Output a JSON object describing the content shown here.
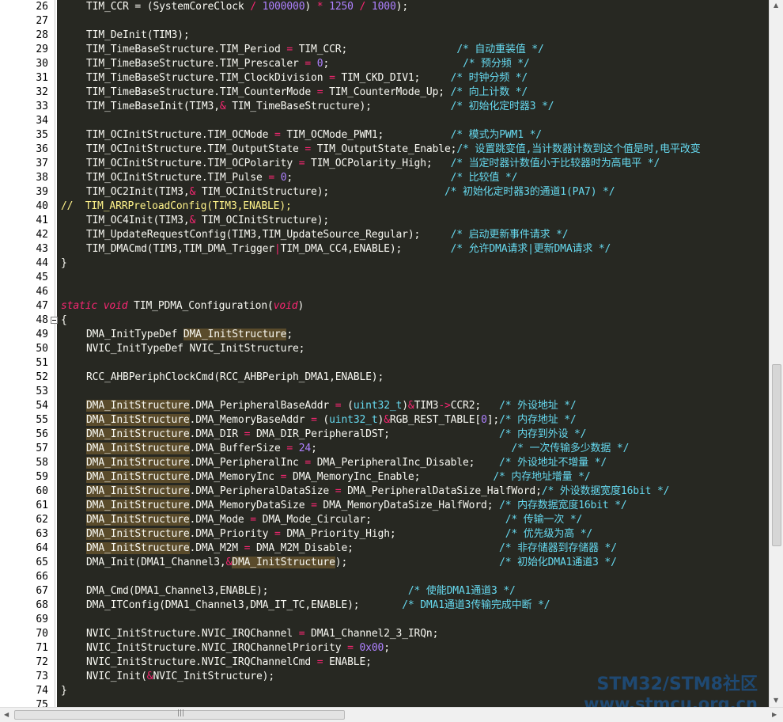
{
  "lines": [
    {
      "n": "26",
      "segs": [
        [
          "TIM_CCR = (SystemCoreClock ",
          ""
        ],
        [
          "/",
          "op"
        ],
        [
          " ",
          ""
        ],
        [
          "1000000",
          "num"
        ],
        [
          ") ",
          ""
        ],
        [
          "*",
          "op"
        ],
        [
          " ",
          ""
        ],
        [
          "1250",
          "num"
        ],
        [
          " ",
          ""
        ],
        [
          "/",
          "op"
        ],
        [
          " ",
          ""
        ],
        [
          "1000",
          "num"
        ],
        [
          ");",
          ""
        ]
      ]
    },
    {
      "n": "27",
      "segs": []
    },
    {
      "n": "28",
      "segs": [
        [
          "TIM_DeInit(TIM3);",
          ""
        ]
      ]
    },
    {
      "n": "29",
      "segs": [
        [
          "TIM_TimeBaseStructure.TIM_Period ",
          ""
        ],
        [
          "=",
          "op"
        ],
        [
          " TIM_CCR;                  ",
          ""
        ],
        [
          "/* 自动重装值 */",
          "cmt"
        ]
      ]
    },
    {
      "n": "30",
      "segs": [
        [
          "TIM_TimeBaseStructure.TIM_Prescaler ",
          ""
        ],
        [
          "=",
          "op"
        ],
        [
          " ",
          ""
        ],
        [
          "0",
          "num"
        ],
        [
          ";                      ",
          ""
        ],
        [
          "/* 预分频 */",
          "cmt"
        ]
      ]
    },
    {
      "n": "31",
      "segs": [
        [
          "TIM_TimeBaseStructure.TIM_ClockDivision ",
          ""
        ],
        [
          "=",
          "op"
        ],
        [
          " TIM_CKD_DIV1;     ",
          ""
        ],
        [
          "/* 时钟分频 */",
          "cmt"
        ]
      ]
    },
    {
      "n": "32",
      "segs": [
        [
          "TIM_TimeBaseStructure.TIM_CounterMode ",
          ""
        ],
        [
          "=",
          "op"
        ],
        [
          " TIM_CounterMode_Up; ",
          ""
        ],
        [
          "/* 向上计数 */",
          "cmt"
        ]
      ]
    },
    {
      "n": "33",
      "segs": [
        [
          "TIM_TimeBaseInit(TIM3,",
          ""
        ],
        [
          "&",
          "op"
        ],
        [
          " TIM_TimeBaseStructure);             ",
          ""
        ],
        [
          "/* 初始化定时器3 */",
          "cmt"
        ]
      ]
    },
    {
      "n": "34",
      "segs": []
    },
    {
      "n": "35",
      "segs": [
        [
          "TIM_OCInitStructure.TIM_OCMode ",
          ""
        ],
        [
          "=",
          "op"
        ],
        [
          " TIM_OCMode_PWM1;           ",
          ""
        ],
        [
          "/* 模式为PWM1 */",
          "cmt"
        ]
      ]
    },
    {
      "n": "36",
      "segs": [
        [
          "TIM_OCInitStructure.TIM_OutputState ",
          ""
        ],
        [
          "=",
          "op"
        ],
        [
          " TIM_OutputState_Enable;",
          ""
        ],
        [
          "/* 设置跳变值,当计数器计数到这个值是时,电平改变",
          "cmt"
        ]
      ]
    },
    {
      "n": "37",
      "segs": [
        [
          "TIM_OCInitStructure.TIM_OCPolarity ",
          ""
        ],
        [
          "=",
          "op"
        ],
        [
          " TIM_OCPolarity_High;   ",
          ""
        ],
        [
          "/* 当定时器计数值小于比较器时为高电平 */",
          "cmt"
        ]
      ]
    },
    {
      "n": "38",
      "segs": [
        [
          "TIM_OCInitStructure.TIM_Pulse ",
          ""
        ],
        [
          "=",
          "op"
        ],
        [
          " ",
          ""
        ],
        [
          "0",
          "num"
        ],
        [
          ";                          ",
          ""
        ],
        [
          "/* 比较值 */",
          "cmt"
        ]
      ]
    },
    {
      "n": "39",
      "segs": [
        [
          "TIM_OC2Init(TIM3,",
          ""
        ],
        [
          "&",
          "op"
        ],
        [
          " TIM_OCInitStructure);                   ",
          ""
        ],
        [
          "/* 初始化定时器3的通道1(PA7) */",
          "cmt"
        ]
      ]
    },
    {
      "n": "40",
      "segs": [
        [
          "//  TIM_ARRPreloadConfig(TIM3,ENABLE);",
          "dcom"
        ]
      ]
    },
    {
      "n": "41",
      "segs": [
        [
          "TIM_OC4Init(TIM3,",
          ""
        ],
        [
          "&",
          "op"
        ],
        [
          " TIM_OCInitStructure);",
          ""
        ]
      ]
    },
    {
      "n": "42",
      "segs": [
        [
          "TIM_UpdateRequestConfig(TIM3,TIM_UpdateSource_Regular);     ",
          ""
        ],
        [
          "/* 启动更新事件请求 */",
          "cmt"
        ]
      ]
    },
    {
      "n": "43",
      "segs": [
        [
          "TIM_DMACmd(TIM3,TIM_DMA_Trigger",
          ""
        ],
        [
          "|",
          "op"
        ],
        [
          "TIM_DMA_CC4,ENABLE);        ",
          ""
        ],
        [
          "/* 允许DMA请求|更新DMA请求 */",
          "cmt"
        ]
      ]
    },
    {
      "n": "44",
      "segs": [
        [
          "}",
          ""
        ]
      ]
    },
    {
      "n": "45",
      "segs": []
    },
    {
      "n": "46",
      "segs": []
    },
    {
      "n": "47",
      "segs": [
        [
          "static",
          "kw"
        ],
        [
          " ",
          ""
        ],
        [
          "void",
          "kw"
        ],
        [
          " TIM_PDMA_Configuration(",
          ""
        ],
        [
          "void",
          "kw"
        ],
        [
          ")",
          ""
        ]
      ]
    },
    {
      "n": "48",
      "segs": [
        [
          "{",
          ""
        ]
      ]
    },
    {
      "n": "49",
      "segs": [
        [
          "DMA_InitTypeDef ",
          ""
        ],
        [
          "DMA_InitStructure",
          "hl"
        ],
        [
          ";",
          ""
        ]
      ]
    },
    {
      "n": "50",
      "segs": [
        [
          "NVIC_InitTypeDef NVIC_InitStructure;",
          ""
        ]
      ]
    },
    {
      "n": "51",
      "segs": []
    },
    {
      "n": "52",
      "segs": [
        [
          "RCC_AHBPeriphClockCmd(RCC_AHBPeriph_DMA1,ENABLE);",
          ""
        ]
      ]
    },
    {
      "n": "53",
      "segs": []
    },
    {
      "n": "54",
      "segs": [
        [
          "DMA_InitStructure",
          "hl"
        ],
        [
          ".DMA_PeripheralBaseAddr ",
          ""
        ],
        [
          "=",
          "op"
        ],
        [
          " (",
          ""
        ],
        [
          "uint32_t",
          "tyn"
        ],
        [
          ")",
          ""
        ],
        [
          "&",
          "op"
        ],
        [
          "TIM3",
          ""
        ],
        [
          "->",
          "op"
        ],
        [
          "CCR2;   ",
          ""
        ],
        [
          "/* 外设地址 */",
          "cmt"
        ]
      ]
    },
    {
      "n": "55",
      "segs": [
        [
          "DMA_InitStructure",
          "hl"
        ],
        [
          ".DMA_MemoryBaseAddr ",
          ""
        ],
        [
          "=",
          "op"
        ],
        [
          " (",
          ""
        ],
        [
          "uint32_t",
          "tyn"
        ],
        [
          ")",
          ""
        ],
        [
          "&",
          "op"
        ],
        [
          "RGB_REST_TABLE[",
          ""
        ],
        [
          "0",
          "num"
        ],
        [
          "];",
          ""
        ],
        [
          "/* 内存地址 */",
          "cmt"
        ]
      ]
    },
    {
      "n": "56",
      "segs": [
        [
          "DMA_InitStructure",
          "hl"
        ],
        [
          ".DMA_DIR ",
          ""
        ],
        [
          "=",
          "op"
        ],
        [
          " DMA_DIR_PeripheralDST;                  ",
          ""
        ],
        [
          "/* 内存到外设 */",
          "cmt"
        ]
      ]
    },
    {
      "n": "57",
      "segs": [
        [
          "DMA_InitStructure",
          "hl"
        ],
        [
          ".DMA_BufferSize ",
          ""
        ],
        [
          "=",
          "op"
        ],
        [
          " ",
          ""
        ],
        [
          "24",
          "num"
        ],
        [
          ";                                ",
          ""
        ],
        [
          "/* 一次传输多少数据 */",
          "cmt"
        ]
      ]
    },
    {
      "n": "58",
      "segs": [
        [
          "DMA_InitStructure",
          "hl"
        ],
        [
          ".DMA_PeripheralInc ",
          ""
        ],
        [
          "=",
          "op"
        ],
        [
          " DMA_PeripheralInc_Disable;    ",
          ""
        ],
        [
          "/* 外设地址不增量 */",
          "cmt"
        ]
      ]
    },
    {
      "n": "59",
      "segs": [
        [
          "DMA_InitStructure",
          "hl"
        ],
        [
          ".DMA_MemoryInc ",
          ""
        ],
        [
          "=",
          "op"
        ],
        [
          " DMA_MemoryInc_Enable;            ",
          ""
        ],
        [
          "/* 内存地址增量 */",
          "cmt"
        ]
      ]
    },
    {
      "n": "60",
      "segs": [
        [
          "DMA_InitStructure",
          "hl"
        ],
        [
          ".DMA_PeripheralDataSize ",
          ""
        ],
        [
          "=",
          "op"
        ],
        [
          " DMA_PeripheralDataSize_HalfWord;",
          ""
        ],
        [
          "/* 外设数据宽度16bit */",
          "cmt"
        ]
      ]
    },
    {
      "n": "61",
      "segs": [
        [
          "DMA_InitStructure",
          "hl"
        ],
        [
          ".DMA_MemoryDataSize ",
          ""
        ],
        [
          "=",
          "op"
        ],
        [
          " DMA_MemoryDataSize_HalfWord; ",
          ""
        ],
        [
          "/* 内存数据宽度16bit */",
          "cmt"
        ]
      ]
    },
    {
      "n": "62",
      "segs": [
        [
          "DMA_InitStructure",
          "hl"
        ],
        [
          ".DMA_Mode ",
          ""
        ],
        [
          "=",
          "op"
        ],
        [
          " DMA_Mode_Circular;                      ",
          ""
        ],
        [
          "/* 传输一次 */",
          "cmt"
        ]
      ]
    },
    {
      "n": "63",
      "segs": [
        [
          "DMA_InitStructure",
          "hl"
        ],
        [
          ".DMA_Priority ",
          ""
        ],
        [
          "=",
          "op"
        ],
        [
          " DMA_Priority_High;                  ",
          ""
        ],
        [
          "/* 优先级为高 */",
          "cmt"
        ]
      ]
    },
    {
      "n": "64",
      "segs": [
        [
          "DMA_InitStructure",
          "hl"
        ],
        [
          ".DMA_M2M ",
          ""
        ],
        [
          "=",
          "op"
        ],
        [
          " DMA_M2M_Disable;                        ",
          ""
        ],
        [
          "/* 非存储器到存储器 */",
          "cmt"
        ]
      ]
    },
    {
      "n": "65",
      "segs": [
        [
          "DMA_Init(DMA1_Channel3,",
          ""
        ],
        [
          "&",
          "op"
        ],
        [
          "DMA_InitStructure",
          "hl"
        ],
        [
          ");                         ",
          ""
        ],
        [
          "/* 初始化DMA1通道3 */",
          "cmt"
        ]
      ]
    },
    {
      "n": "66",
      "segs": []
    },
    {
      "n": "67",
      "segs": [
        [
          "DMA_Cmd(DMA1_Channel3,ENABLE);                       ",
          ""
        ],
        [
          "/* 使能DMA1通道3 */",
          "cmt"
        ]
      ]
    },
    {
      "n": "68",
      "segs": [
        [
          "DMA_ITConfig(DMA1_Channel3,DMA_IT_TC,ENABLE);       ",
          ""
        ],
        [
          "/* DMA1通道3传输完成中断 */",
          "cmt"
        ]
      ]
    },
    {
      "n": "69",
      "segs": []
    },
    {
      "n": "70",
      "segs": [
        [
          "NVIC_InitStructure.NVIC_IRQChannel ",
          ""
        ],
        [
          "=",
          "op"
        ],
        [
          " DMA1_Channel2_3_IRQn;",
          ""
        ]
      ]
    },
    {
      "n": "71",
      "segs": [
        [
          "NVIC_InitStructure.NVIC_IRQChannelPriority ",
          ""
        ],
        [
          "=",
          "op"
        ],
        [
          " ",
          ""
        ],
        [
          "0x00",
          "num"
        ],
        [
          ";",
          ""
        ]
      ]
    },
    {
      "n": "72",
      "segs": [
        [
          "NVIC_InitStructure.NVIC_IRQChannelCmd ",
          ""
        ],
        [
          "=",
          "op"
        ],
        [
          " ENABLE;",
          ""
        ]
      ]
    },
    {
      "n": "73",
      "segs": [
        [
          "NVIC_Init(",
          ""
        ],
        [
          "&",
          "op"
        ],
        [
          "NVIC_InitStructure);",
          ""
        ]
      ]
    },
    {
      "n": "74",
      "segs": [
        [
          "}",
          ""
        ]
      ]
    },
    {
      "n": "75",
      "segs": []
    }
  ],
  "watermark": {
    "line1": "STM32/STM8社区",
    "line2": "www.stmcu.org.cn"
  },
  "colors": {
    "background": "#272822",
    "comment": "#66d9ef",
    "number": "#ae81ff",
    "operator": "#f92672",
    "highlight": "#5a4b2b"
  }
}
